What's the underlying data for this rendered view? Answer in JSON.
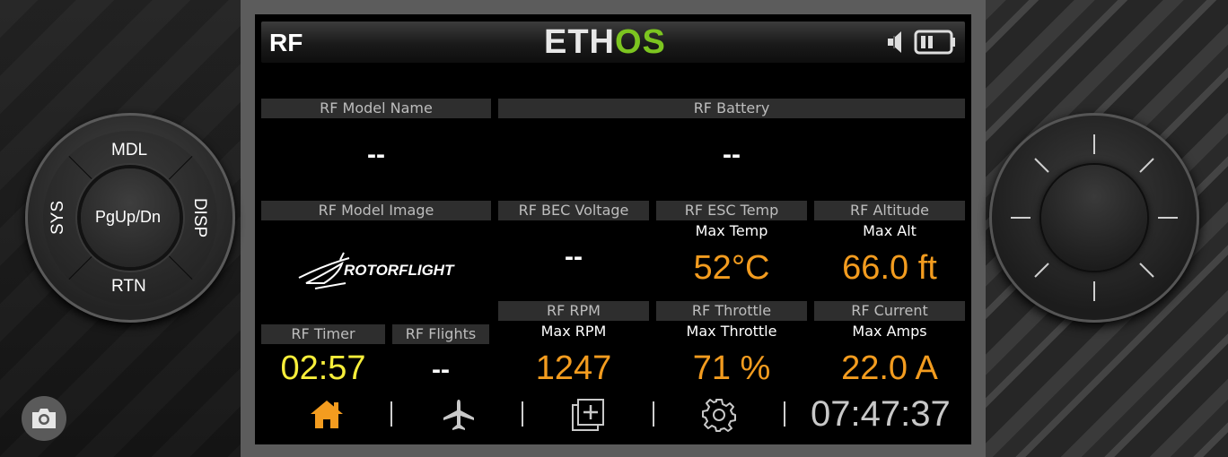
{
  "header": {
    "title": "RF",
    "brand_part1": "ETH",
    "brand_part2": "OS"
  },
  "colors": {
    "value_orange": "#f39c1f",
    "timer_yellow": "#f7ee3a",
    "brand_green": "#7cc520"
  },
  "widgets": {
    "model_name": {
      "title": "RF Model Name",
      "value": "--"
    },
    "battery": {
      "title": "RF Battery",
      "value": "--"
    },
    "model_image": {
      "title": "RF Model Image",
      "logo_text": "ROTORFLIGHT"
    },
    "bec_voltage": {
      "title": "RF BEC Voltage",
      "value": "--"
    },
    "esc_temp": {
      "title": "RF ESC Temp",
      "sub": "Max Temp",
      "value": "52°C"
    },
    "altitude": {
      "title": "RF Altitude",
      "sub": "Max Alt",
      "value": "66.0 ft"
    },
    "timer": {
      "title": "RF Timer",
      "value": "02:57"
    },
    "flights": {
      "title": "RF Flights",
      "value": "--"
    },
    "rpm": {
      "title": "RF RPM",
      "sub": "Max RPM",
      "value": "1247"
    },
    "throttle": {
      "title": "RF Throttle",
      "sub": "Max Throttle",
      "value": "71 %"
    },
    "current": {
      "title": "RF Current",
      "sub": "Max Amps",
      "value": "22.0 A"
    }
  },
  "navbar": {
    "icons": [
      "home-icon",
      "airplane-icon",
      "add-page-icon",
      "gear-icon"
    ],
    "clock": "07:47:37"
  },
  "status_icons": [
    "speaker-icon",
    "battery-icon"
  ],
  "dial": {
    "top": "MDL",
    "left": "SYS",
    "right": "DISP",
    "bottom": "RTN",
    "center": "PgUp/Dn"
  },
  "screenshot_icon": "camera-icon"
}
